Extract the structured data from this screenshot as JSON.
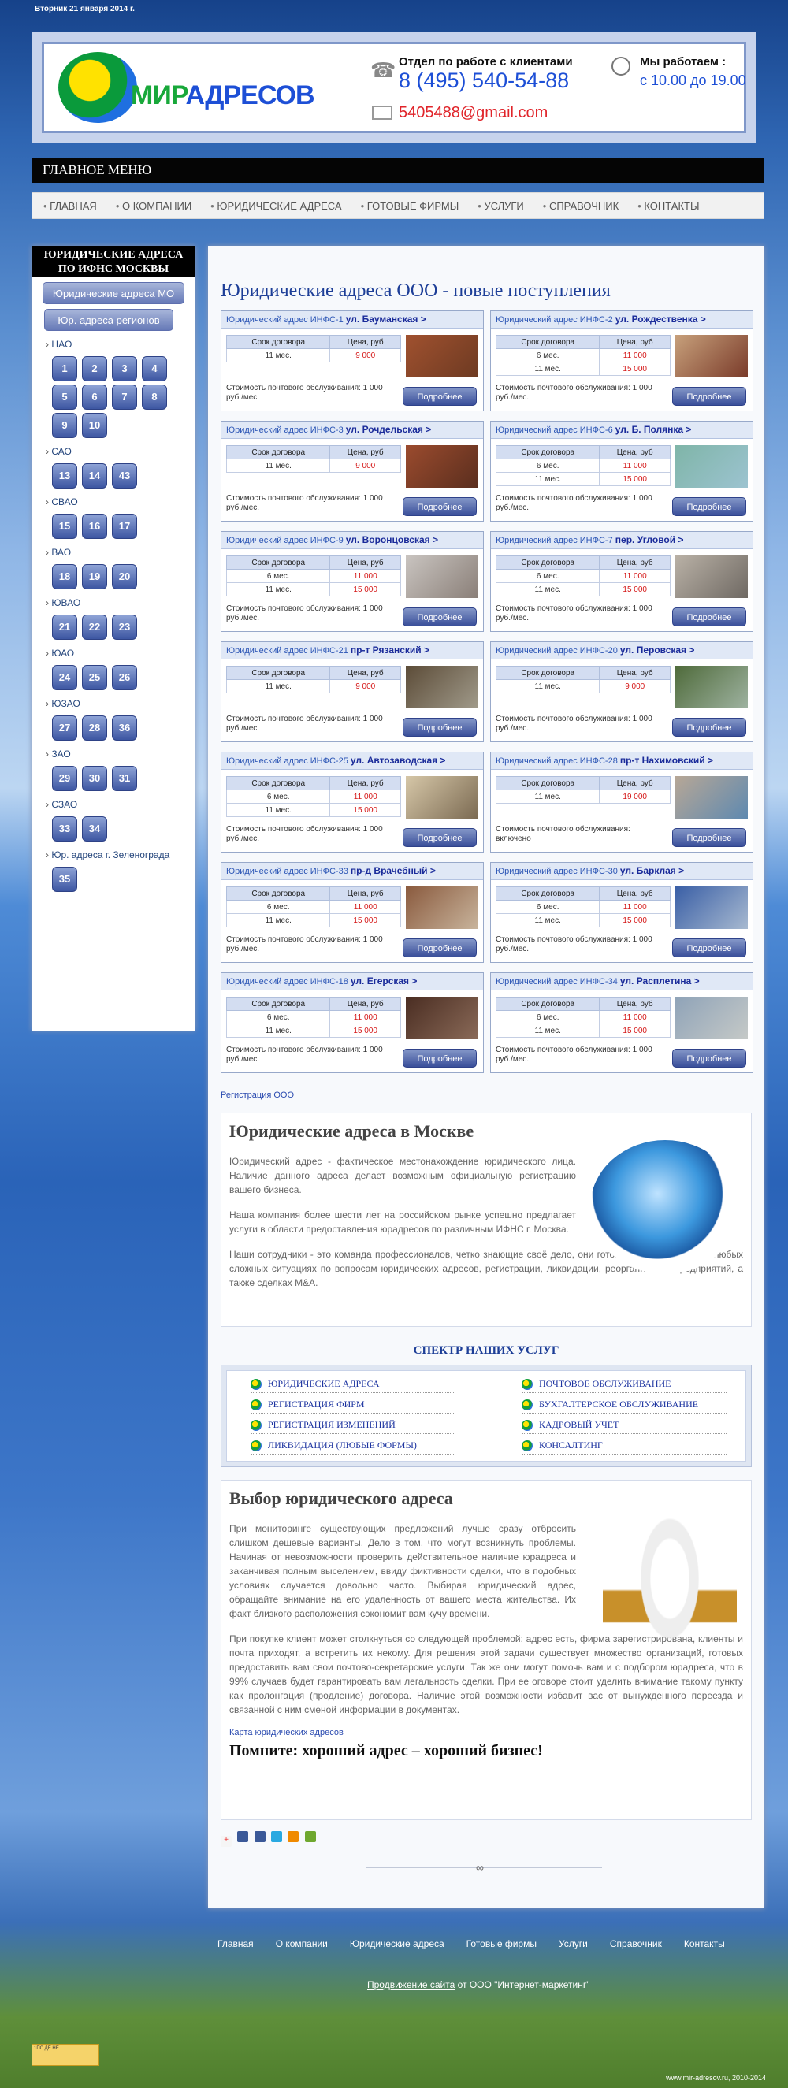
{
  "date": "Вторник 21 января 2014 г.",
  "header": {
    "logo": {
      "prefix": "МИР",
      "rest": "АДРЕСОВ"
    },
    "contact_label": "Отдел по работе с клиентами",
    "phone": "8 (495) 540-54-88",
    "email": "5405488@gmail.com",
    "hours_label": "Мы работаем :",
    "hours": "с 10.00 до 19.00"
  },
  "menu": {
    "title": "ГЛАВНОЕ МЕНЮ",
    "items": [
      "ГЛАВНАЯ",
      "О КОМПАНИИ",
      "ЮРИДИЧЕСКИЕ АДРЕСА",
      "ГОТОВЫЕ ФИРМЫ",
      "УСЛУГИ",
      "СПРАВОЧНИК",
      "КОНТАКТЫ"
    ]
  },
  "sidebar": {
    "title": "ЮРИДИЧЕСКИЕ АДРЕСА ПО ИФНС МОСКВЫ",
    "btn_mo": "Юридические адреса МО",
    "btn_regions": "Юр. адреса регионов",
    "groups": [
      {
        "name": "ЦАО",
        "nums": [
          "1",
          "2",
          "3",
          "4",
          "5",
          "6",
          "7",
          "8",
          "9",
          "10"
        ]
      },
      {
        "name": "САО",
        "nums": [
          "13",
          "14",
          "43"
        ]
      },
      {
        "name": "СВАО",
        "nums": [
          "15",
          "16",
          "17"
        ]
      },
      {
        "name": "ВАО",
        "nums": [
          "18",
          "19",
          "20"
        ]
      },
      {
        "name": "ЮВАО",
        "nums": [
          "21",
          "22",
          "23"
        ]
      },
      {
        "name": "ЮАО",
        "nums": [
          "24",
          "25",
          "26"
        ]
      },
      {
        "name": "ЮЗАО",
        "nums": [
          "27",
          "28",
          "36"
        ]
      },
      {
        "name": "ЗАО",
        "nums": [
          "29",
          "30",
          "31"
        ]
      },
      {
        "name": "СЗАО",
        "nums": [
          "33",
          "34"
        ]
      },
      {
        "name": "Юр. адреса г. Зеленограда",
        "nums": [
          "35"
        ]
      }
    ]
  },
  "main": {
    "title": "Юридические адреса ООО - новые поступления",
    "table_head": {
      "term": "Срок договора",
      "price": "Цена, руб"
    },
    "more": "Подробнее",
    "cards": [
      {
        "prefix": "Юридический адрес ИНФС-1",
        "street": "ул. Бауманская >",
        "rows": [
          [
            "11 мес.",
            "9 000"
          ]
        ],
        "service": "Стоимость почтового обслуживания: 1 000 руб./мес."
      },
      {
        "prefix": "Юридический адрес ИНФС-2",
        "street": "ул. Рождественка >",
        "rows": [
          [
            "6 мес.",
            "11 000"
          ],
          [
            "11 мес.",
            "15 000"
          ]
        ],
        "service": "Стоимость почтового обслуживания: 1 000 руб./мес."
      },
      {
        "prefix": "Юридический адрес ИНФС-3",
        "street": "ул. Рочдельская >",
        "rows": [
          [
            "11 мес.",
            "9 000"
          ]
        ],
        "service": "Стоимость почтового обслуживания: 1 000 руб./мес."
      },
      {
        "prefix": "Юридический адрес ИНФС-6",
        "street": "ул. Б. Полянка >",
        "rows": [
          [
            "6 мес.",
            "11 000"
          ],
          [
            "11 мес.",
            "15 000"
          ]
        ],
        "service": "Стоимость почтового обслуживания: 1 000 руб./мес."
      },
      {
        "prefix": "Юридический адрес ИНФС-9",
        "street": "ул. Воронцовская >",
        "rows": [
          [
            "6 мес.",
            "11 000"
          ],
          [
            "11 мес.",
            "15 000"
          ]
        ],
        "service": "Стоимость почтового обслуживания: 1 000 руб./мес."
      },
      {
        "prefix": "Юридический адрес ИНФС-7",
        "street": "пер. Угловой >",
        "rows": [
          [
            "6 мес.",
            "11 000"
          ],
          [
            "11 мес.",
            "15 000"
          ]
        ],
        "service": "Стоимость почтового обслуживания: 1 000 руб./мес."
      },
      {
        "prefix": "Юридический адрес ИНФС-21",
        "street": "пр-т Рязанский >",
        "rows": [
          [
            "11 мес.",
            "9 000"
          ]
        ],
        "service": "Стоимость почтового обслуживания: 1 000 руб./мес."
      },
      {
        "prefix": "Юридический адрес ИНФС-20",
        "street": "ул. Перовская >",
        "rows": [
          [
            "11 мес.",
            "9 000"
          ]
        ],
        "service": "Стоимость почтового обслуживания: 1 000 руб./мес."
      },
      {
        "prefix": "Юридический адрес ИНФС-25",
        "street": "ул. Автозаводская >",
        "rows": [
          [
            "6 мес.",
            "11 000"
          ],
          [
            "11 мес.",
            "15 000"
          ]
        ],
        "service": "Стоимость почтового обслуживания: 1 000 руб./мес."
      },
      {
        "prefix": "Юридический адрес ИНФС-28",
        "street": "пр-т Нахимовский >",
        "rows": [
          [
            "11 мес.",
            "19 000"
          ]
        ],
        "service": "Стоимость почтового обслуживания: включено"
      },
      {
        "prefix": "Юридический адрес ИНФС-33",
        "street": "пр-д Врачебный >",
        "rows": [
          [
            "6 мес.",
            "11 000"
          ],
          [
            "11 мес.",
            "15 000"
          ]
        ],
        "service": "Стоимость почтового обслуживания: 1 000 руб./мес."
      },
      {
        "prefix": "Юридический адрес ИНФС-30",
        "street": "ул. Барклая >",
        "rows": [
          [
            "6 мес.",
            "11 000"
          ],
          [
            "11 мес.",
            "15 000"
          ]
        ],
        "service": "Стоимость почтового обслуживания: 1 000 руб./мес."
      },
      {
        "prefix": "Юридический адрес ИНФС-18",
        "street": "ул. Егерская >",
        "rows": [
          [
            "6 мес.",
            "11 000"
          ],
          [
            "11 мес.",
            "15 000"
          ]
        ],
        "service": "Стоимость почтового обслуживания: 1 000 руб./мес."
      },
      {
        "prefix": "Юридический адрес ИНФС-34",
        "street": "ул. Расплетина >",
        "rows": [
          [
            "6 мес.",
            "11 000"
          ],
          [
            "11 мес.",
            "15 000"
          ]
        ],
        "service": "Стоимость почтового обслуживания: 1 000 руб./мес."
      }
    ],
    "reg_link": "Регистрация ООО",
    "moscow": {
      "title": "Юридические адреса в Москве",
      "p1": "Юридический адрес - фактическое местонахождение юридического лица. Наличие данного адреса делает возможным официальную регистрацию вашего бизнеса.",
      "p2": "Наша компания более шести лет на российском рынке успешно предлагает услуги в области предоставления юрадресов по различным ИФНС г. Москва.",
      "p3": "Наши сотрудники - это команда профессионалов, четко знающие своё дело, они готовы оказать помощь в любых сложных ситуациях по вопросам юридических адресов, регистрации, ликвидации, реорганизации предприятий, а также сделках М&А."
    },
    "services_title": "СПЕКТР НАШИХ УСЛУГ",
    "services": [
      "ЮРИДИЧЕСКИЕ АДРЕСА",
      "РЕГИСТРАЦИЯ ФИРМ",
      "РЕГИСТРАЦИЯ ИЗМЕНЕНИЙ",
      "ЛИКВИДАЦИЯ (ЛЮБЫЕ ФОРМЫ)",
      "ПОЧТОВОЕ ОБСЛУЖИВАНИЕ",
      "БУХГАЛТЕРСКОЕ ОБСЛУЖИВАНИЕ",
      "КАДРОВЫЙ УЧЕТ",
      "КОНСАЛТИНГ"
    ],
    "choice": {
      "title": "Выбор юридического адреса",
      "p1": "При мониторинге существующих предложений лучше сразу отбросить слишком дешевые варианты. Дело в том, что могут возникнуть проблемы. Начиная от невозможности проверить действительное наличие юрадреса и заканчивая полным выселением, ввиду фиктивности сделки, что в подобных условиях случается довольно часто. Выбирая юридический адрес, обращайте внимание на его удаленность от вашего места жительства. Их факт близкого расположения сэкономит вам кучу времени.",
      "p2": "При покупке клиент может столкнуться со следующей проблемой: адрес есть, фирма зарегистрирована, клиенты и почта приходят, а встретить их некому. Для решения этой задачи существует множество организаций, готовых предоставить вам свои почтово-секретарские услуги. Так же они могут помочь вам и с подбором юрадреса, что в 99% случаев будет гарантировать вам легальность сделки. При ее оговоре стоит уделить внимание такому пункту как пролонгация (продление) договора. Наличие этой возможности избавит вас от вынужденного переезда и связанной с ним сменой информации в документах.",
      "map_link": "Карта юридических адресов",
      "slogan": "Помните: хороший адрес – хороший бизнес!"
    }
  },
  "footer": {
    "links": [
      "Главная",
      "О компании",
      "Юридические адреса",
      "Готовые фирмы",
      "Услуги",
      "Справочник",
      "Контакты"
    ],
    "promo_link": "Продвижение сайта",
    "promo_rest": " от ООО \"Интернет-маркетинг\"",
    "badge": "1ПС ДЕ НЕ",
    "copyright": "www.mir-adresov.ru, 2010-2014"
  }
}
